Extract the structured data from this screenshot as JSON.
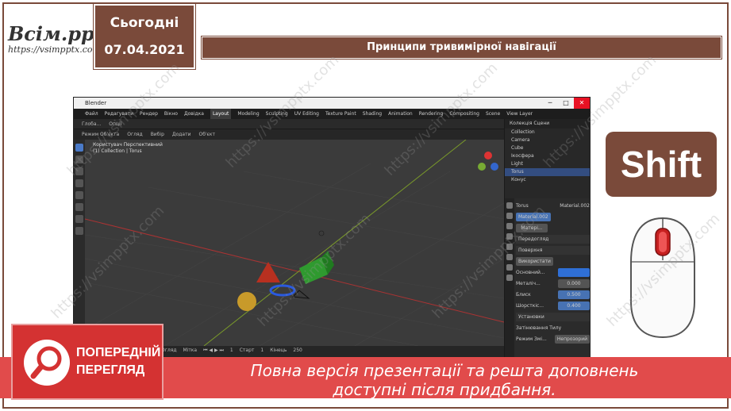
{
  "logo": {
    "main": "Всім.pptx",
    "url": "https://vsimpptx.com"
  },
  "date": {
    "day": "Сьогодні",
    "date": "07.04.2021"
  },
  "title": "Принципи тривимірної навігації",
  "blender": {
    "window_title": "Blender",
    "menu": [
      "Файл",
      "Редагувати",
      "Рендер",
      "Вікно",
      "Довідка"
    ],
    "workspaces": [
      "Layout",
      "Modeling",
      "Sculpting",
      "UV Editing",
      "Texture Paint",
      "Shading",
      "Animation",
      "Rendering",
      "Compositing"
    ],
    "scene_label": "Scene",
    "view_layer": "View Layer",
    "toolbar": [
      "Режим Об'єкта",
      "Огляд",
      "Вибір",
      "Додати",
      "Об'єкт"
    ],
    "transform_orientation": "Глоба...",
    "overlays_label": "Опції",
    "viewport_label_1": "Користувач Перспективний",
    "viewport_label_2": "(1) Collection | Torus",
    "outliner": {
      "header": "Колекція Сцени",
      "items": [
        "Collection",
        "Camera",
        "Cube",
        "Ікосфера",
        "Light",
        "Torus",
        "Конус"
      ]
    },
    "props": {
      "object": "Torus",
      "material_slot": "Material.002",
      "material_name": "Матері...",
      "sections": [
        "Передогляд",
        "Поверхня",
        "Установки"
      ],
      "surface_button": "Використати",
      "fields": [
        {
          "label": "Основний...",
          "value": ""
        },
        {
          "label": "Металіч...",
          "value": "0.000"
        },
        {
          "label": "Блиск",
          "value": "0.500"
        },
        {
          "label": "Шорсткіс...",
          "value": "0.400"
        }
      ],
      "backface_label": "Затінювання Тилу",
      "blend_mode_label": "Режим Змі...",
      "blend_mode_value": "Непрозорий"
    },
    "timeline": {
      "menu": [
        "Огляд",
        "Мітка"
      ],
      "frame_current": "1",
      "start_label": "Старт",
      "start": "1",
      "end_label": "Кінець",
      "end": "250"
    }
  },
  "shift_key": "Shift",
  "preview": {
    "line1": "ПОПЕРЕДНІЙ",
    "line2": "ПЕРЕГЛЯД"
  },
  "banner": {
    "line1": "Повна версія презентації та решта доповнень",
    "line2": "доступні після придбання."
  },
  "watermark": "https://vsimpptx.com",
  "colors": {
    "accent": "#7a4a3a",
    "banner": "#e14b4b",
    "blender_bg": "#3b3b3b",
    "selection": "#4772b3"
  }
}
